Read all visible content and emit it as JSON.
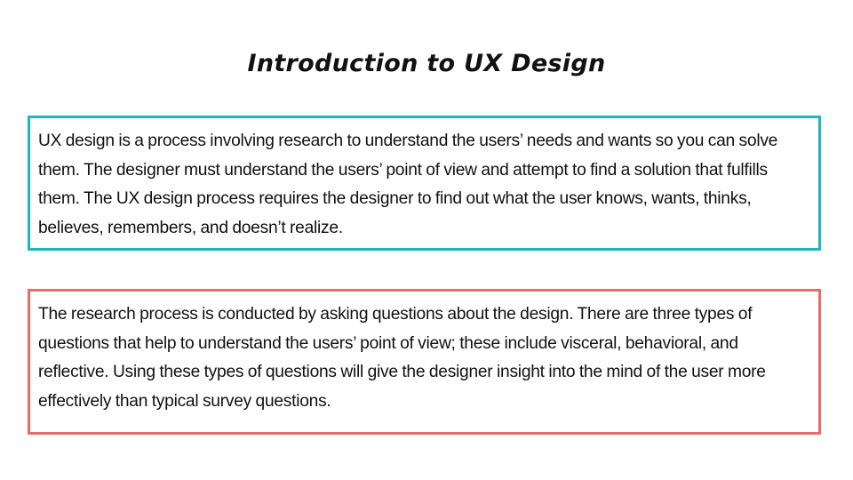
{
  "slide": {
    "title": "Introduction to UX Design",
    "paragraphs": [
      {
        "text": "UX design is a process involving research to understand the users’ needs and wants so you can solve them. The designer must understand the users’ point of view and attempt to find a solution that fulfills them. The UX design process requires the designer to find out what the user knows, wants, thinks, believes, remembers, and doesn’t realize.",
        "border_color": "#1fb5c3"
      },
      {
        "text": "The research process is conducted by asking questions about the design. There are three types of questions that help to understand the users’ point of view; these include visceral, behavioral, and reflective. Using these types of questions will give the designer insight into the mind of the user more effectively than typical survey questions.",
        "border_color": "#e96a6a"
      }
    ]
  }
}
